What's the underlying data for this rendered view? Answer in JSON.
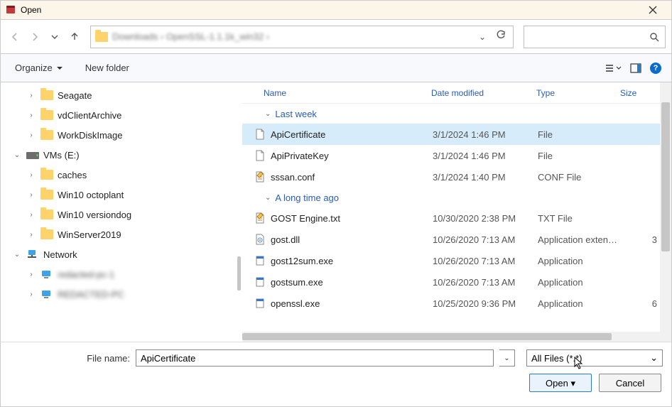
{
  "title": "Open",
  "nav": {
    "crumbs": "Downloads › OpenSSL-1.1.1k_win32 ›"
  },
  "cmd": {
    "organize": "Organize",
    "newfolder": "New folder",
    "help": "?"
  },
  "tree": [
    {
      "indent": 36,
      "exp": "›",
      "icon": "folder",
      "label": "Seagate"
    },
    {
      "indent": 36,
      "exp": "›",
      "icon": "folder",
      "label": "vdClientArchive"
    },
    {
      "indent": 36,
      "exp": "›",
      "icon": "folder",
      "label": "WorkDiskImage"
    },
    {
      "indent": 16,
      "exp": "⌄",
      "icon": "drive",
      "label": "VMs (E:)"
    },
    {
      "indent": 36,
      "exp": "›",
      "icon": "folder",
      "label": "caches"
    },
    {
      "indent": 36,
      "exp": "›",
      "icon": "folder",
      "label": "Win10 octoplant"
    },
    {
      "indent": 36,
      "exp": "›",
      "icon": "folder",
      "label": "Win10 versiondog"
    },
    {
      "indent": 36,
      "exp": "›",
      "icon": "folder",
      "label": "WinServer2019"
    },
    {
      "indent": 16,
      "exp": "⌄",
      "icon": "net",
      "label": "Network"
    },
    {
      "indent": 36,
      "exp": "›",
      "icon": "comp",
      "label": "redacted-pc-1",
      "blur": true
    },
    {
      "indent": 36,
      "exp": "›",
      "icon": "comp",
      "label": "REDACTED-PC",
      "blur": true
    }
  ],
  "columns": {
    "name": "Name",
    "date": "Date modified",
    "type": "Type",
    "size": "Size"
  },
  "groups": [
    {
      "label": "Last week",
      "rows": [
        {
          "icon": "file",
          "name": "ApiCertificate",
          "date": "3/1/2024 1:46 PM",
          "type": "File",
          "size": "",
          "sel": true
        },
        {
          "icon": "file",
          "name": "ApiPrivateKey",
          "date": "3/1/2024 1:46 PM",
          "type": "File",
          "size": ""
        },
        {
          "icon": "conf",
          "name": "sssan.conf",
          "date": "3/1/2024 1:40 PM",
          "type": "CONF File",
          "size": ""
        }
      ]
    },
    {
      "label": "A long time ago",
      "rows": [
        {
          "icon": "conf",
          "name": "GOST Engine.txt",
          "date": "10/30/2020 2:38 PM",
          "type": "TXT File",
          "size": ""
        },
        {
          "icon": "dll",
          "name": "gost.dll",
          "date": "10/26/2020 7:13 AM",
          "type": "Application exten…",
          "size": "3"
        },
        {
          "icon": "exe",
          "name": "gost12sum.exe",
          "date": "10/26/2020 7:13 AM",
          "type": "Application",
          "size": ""
        },
        {
          "icon": "exe",
          "name": "gostsum.exe",
          "date": "10/26/2020 7:13 AM",
          "type": "Application",
          "size": ""
        },
        {
          "icon": "exe",
          "name": "openssl.exe",
          "date": "10/25/2020 9:36 PM",
          "type": "Application",
          "size": "6"
        }
      ]
    }
  ],
  "filename": {
    "label": "File name:",
    "value": "ApiCertificate"
  },
  "filter": "All Files (*.*)",
  "buttons": {
    "open": "Open",
    "cancel": "Cancel"
  }
}
